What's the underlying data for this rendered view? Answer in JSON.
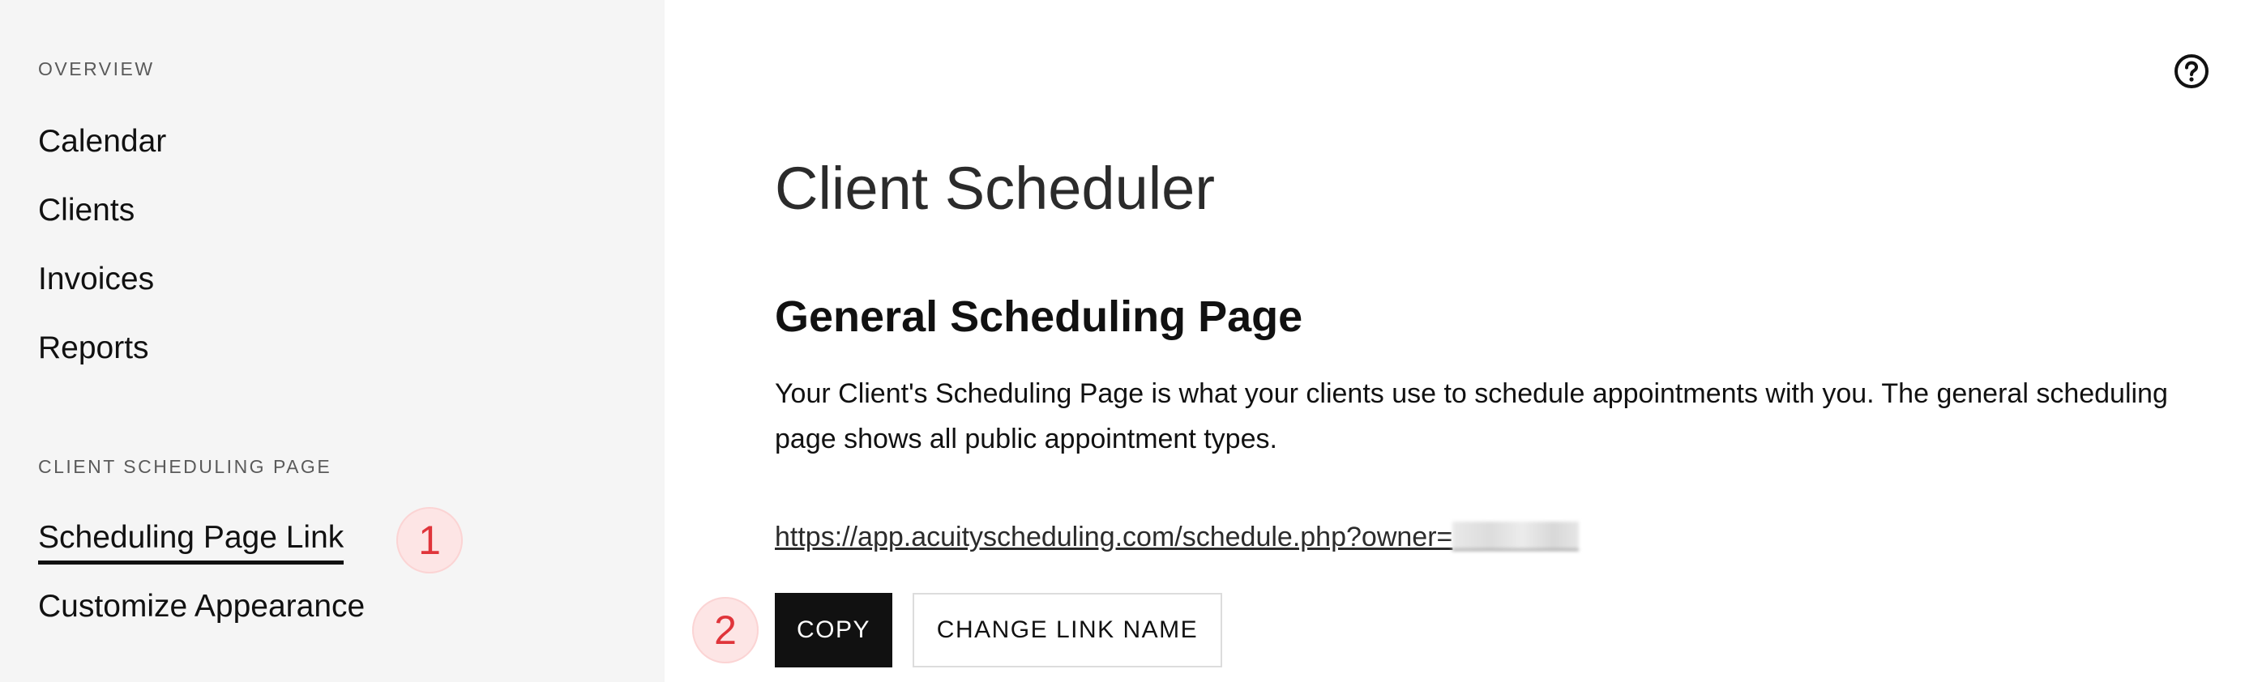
{
  "sidebar": {
    "overview_label": "OVERVIEW",
    "overview_items": [
      {
        "label": "Calendar"
      },
      {
        "label": "Clients"
      },
      {
        "label": "Invoices"
      },
      {
        "label": "Reports"
      }
    ],
    "scheduling_label": "CLIENT SCHEDULING PAGE",
    "scheduling_items": [
      {
        "label": "Scheduling Page Link",
        "active": true
      },
      {
        "label": "Customize Appearance",
        "active": false
      }
    ]
  },
  "annotations": {
    "step1": "1",
    "step2": "2"
  },
  "main": {
    "help_icon": "question-circle-icon",
    "title": "Client Scheduler",
    "section_title": "General Scheduling Page",
    "description": "Your Client's Scheduling Page is what your clients use to schedule appointments with you. The general scheduling page shows all public appointment types.",
    "link_text": "https://app.acuityscheduling.com/schedule.php?owner=",
    "copy_label": "COPY",
    "change_link_label": "CHANGE LINK NAME"
  },
  "colors": {
    "sidebar_bg": "#f5f5f5",
    "primary_button": "#111111",
    "badge_bg": "#fde5e5",
    "badge_text": "#e0353b"
  }
}
